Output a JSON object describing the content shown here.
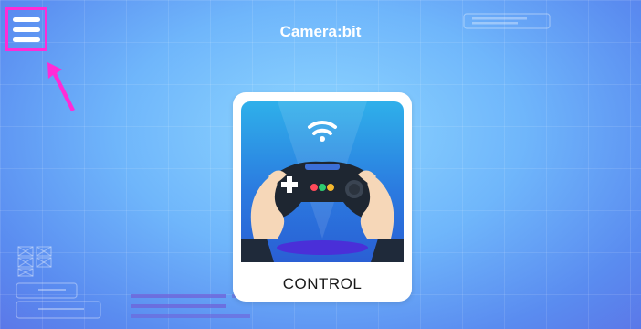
{
  "app": {
    "title": "Camera:bit"
  },
  "menu": {
    "icon": "hamburger-menu-icon"
  },
  "cards": [
    {
      "label": "CONTROL",
      "icon": "gamepad-icon"
    }
  ],
  "colors": {
    "highlight": "#ff2bd6",
    "accent": "#5aa8f7",
    "text": "#ffffff"
  }
}
